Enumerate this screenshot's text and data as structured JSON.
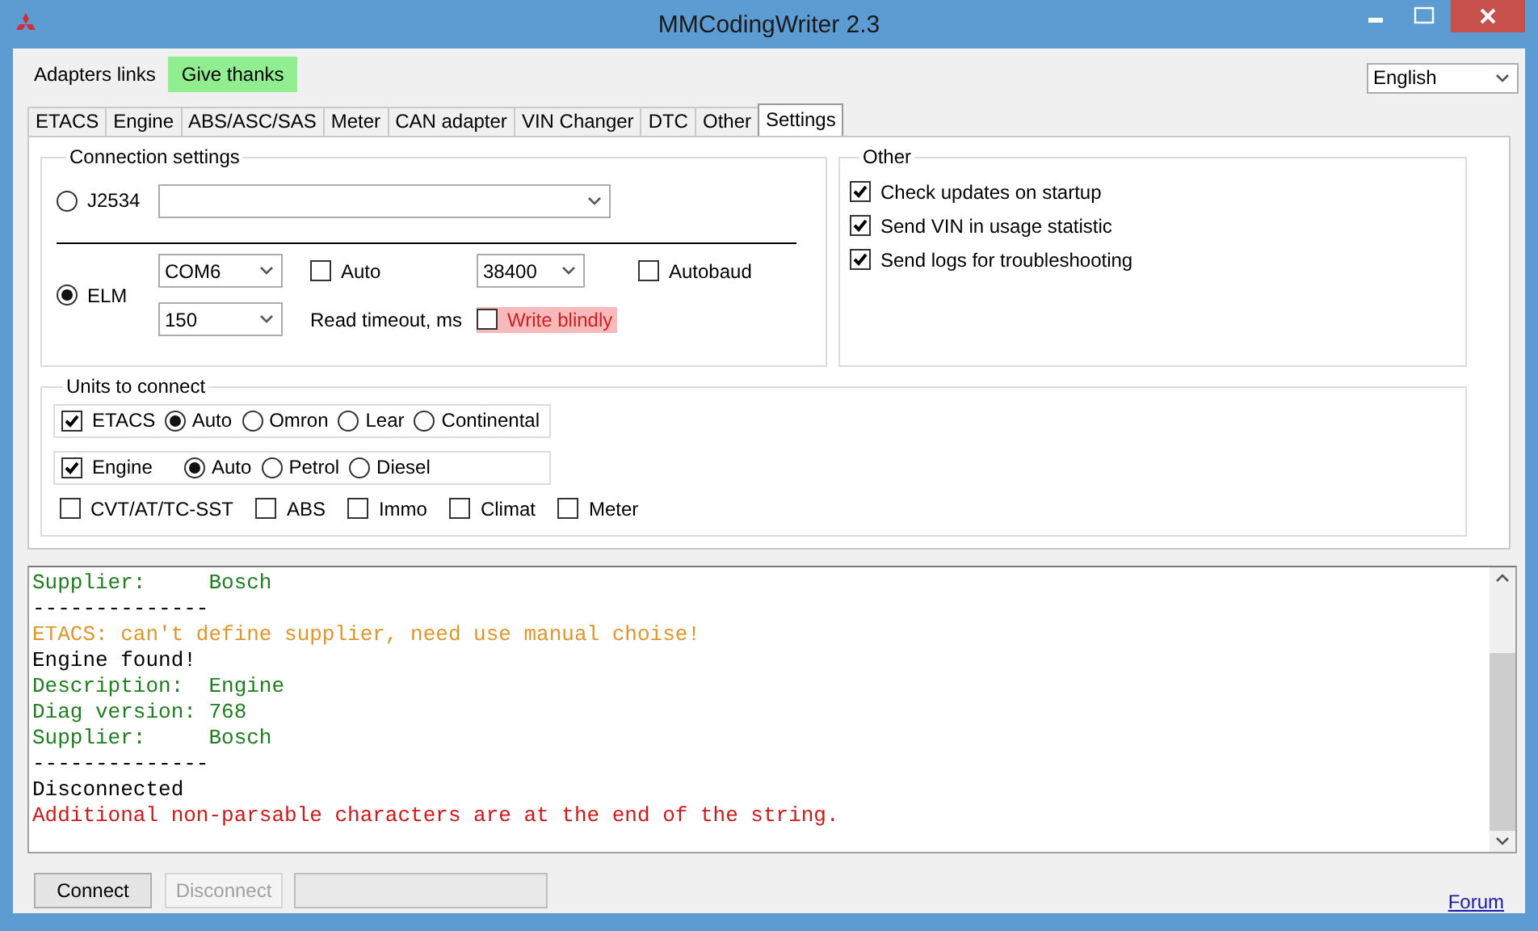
{
  "window": {
    "title": "MMCodingWriter 2.3"
  },
  "menu": [
    {
      "label": "Adapters links",
      "highlighted": false
    },
    {
      "label": "Give thanks",
      "highlighted": true
    }
  ],
  "language": {
    "value": "English"
  },
  "tabs": [
    {
      "label": "ETACS",
      "selected": false
    },
    {
      "label": "Engine",
      "selected": false
    },
    {
      "label": "ABS/ASC/SAS",
      "selected": false
    },
    {
      "label": "Meter",
      "selected": false
    },
    {
      "label": "CAN adapter",
      "selected": false
    },
    {
      "label": "VIN Changer",
      "selected": false
    },
    {
      "label": "DTC",
      "selected": false
    },
    {
      "label": "Other",
      "selected": false
    },
    {
      "label": "Settings",
      "selected": true
    }
  ],
  "connection": {
    "title": "Connection settings",
    "j2534": {
      "label": "J2534",
      "selected": false
    },
    "elm": {
      "label": "ELM",
      "selected": true,
      "port": "COM6",
      "baud": "38400",
      "timeout": "150",
      "timeout_label": "Read timeout, ms",
      "auto": {
        "label": "Auto",
        "checked": false
      },
      "autobaud": {
        "label": "Autobaud",
        "checked": false
      },
      "write_blindly": {
        "label": "Write blindly",
        "checked": false,
        "highlighted": true
      }
    }
  },
  "other": {
    "title": "Other",
    "options": [
      {
        "label": "Check updates on startup",
        "checked": true
      },
      {
        "label": "Send VIN in usage statistic",
        "checked": true
      },
      {
        "label": "Send logs for troubleshooting",
        "checked": true
      }
    ]
  },
  "units": {
    "title": "Units to connect",
    "groups": [
      {
        "label": "ETACS",
        "checked": true,
        "variants": [
          {
            "label": "Auto",
            "selected": true
          },
          {
            "label": "Omron",
            "selected": false
          },
          {
            "label": "Lear",
            "selected": false
          },
          {
            "label": "Continental",
            "selected": false
          }
        ]
      },
      {
        "label": "Engine",
        "checked": true,
        "variants": [
          {
            "label": "Auto",
            "selected": true
          },
          {
            "label": "Petrol",
            "selected": false
          },
          {
            "label": "Diesel",
            "selected": false
          }
        ]
      }
    ],
    "extras": [
      {
        "label": "CVT/AT/TC-SST",
        "checked": false
      },
      {
        "label": "ABS",
        "checked": false
      },
      {
        "label": "Immo",
        "checked": false
      },
      {
        "label": "Climat",
        "checked": false
      },
      {
        "label": "Meter",
        "checked": false
      }
    ]
  },
  "log": {
    "lines": [
      {
        "text": "Supplier:     Bosch",
        "kind": "info"
      },
      {
        "text": "--------------",
        "kind": "plain"
      },
      {
        "text": "ETACS: can't define supplier, need use manual choise!",
        "kind": "warn"
      },
      {
        "text": "Engine found!",
        "kind": "plain"
      },
      {
        "text": "Description:  Engine",
        "kind": "info"
      },
      {
        "text": "Diag version: 768",
        "kind": "info"
      },
      {
        "text": "Supplier:     Bosch",
        "kind": "info"
      },
      {
        "text": "--------------",
        "kind": "plain"
      },
      {
        "text": "Disconnected",
        "kind": "plain"
      },
      {
        "text": "Additional non-parsable characters are at the end of the string.",
        "kind": "error"
      }
    ]
  },
  "footer": {
    "buttons": [
      {
        "label": "Connect",
        "disabled": false
      },
      {
        "label": "Disconnect",
        "disabled": true
      }
    ],
    "link": "Forum"
  }
}
